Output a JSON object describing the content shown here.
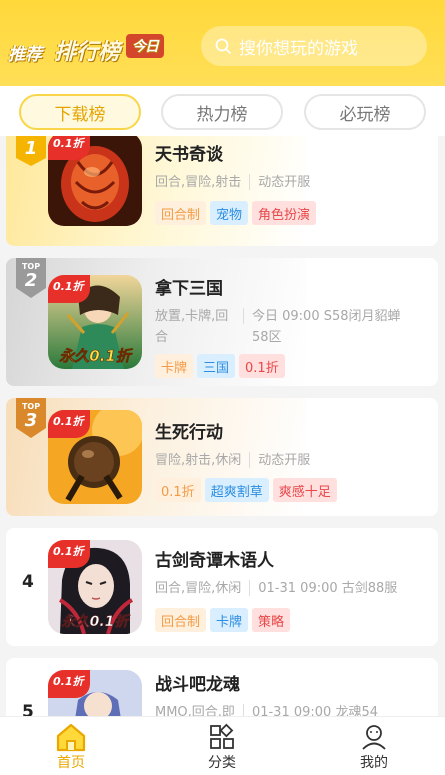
{
  "header": {
    "tabs": [
      "推荐",
      "排行榜",
      "今日"
    ],
    "search_placeholder": "搜你想玩的游戏"
  },
  "rank_tabs": [
    {
      "label": "下载榜",
      "active": true
    },
    {
      "label": "热力榜",
      "active": false
    },
    {
      "label": "必玩榜",
      "active": false
    }
  ],
  "games": [
    {
      "rank": "1",
      "badge_top": "",
      "discount": "0.1折",
      "title": "天书奇谈",
      "genre": "回合,冒险,射击",
      "info": "动态开服",
      "tags": [
        {
          "text": "回合制",
          "color": "orange"
        },
        {
          "text": "宠物",
          "color": "blue"
        },
        {
          "text": "角色扮演",
          "color": "red"
        }
      ]
    },
    {
      "rank": "2",
      "badge_top": "TOP",
      "discount": "0.1折",
      "title": "拿下三国",
      "genre": "放置,卡牌,回合",
      "info": "今日 09:00 S58闭月貂蝉58区",
      "icon_text": "永久0.1折",
      "tags": [
        {
          "text": "卡牌",
          "color": "orange"
        },
        {
          "text": "三国",
          "color": "blue"
        },
        {
          "text": "0.1折",
          "color": "red"
        }
      ]
    },
    {
      "rank": "3",
      "badge_top": "TOP",
      "discount": "0.1折",
      "title": "生死行动",
      "genre": "冒险,射击,休闲",
      "info": "动态开服",
      "tags": [
        {
          "text": "0.1折",
          "color": "orange"
        },
        {
          "text": "超爽割草",
          "color": "blue"
        },
        {
          "text": "爽感十足",
          "color": "red"
        }
      ]
    },
    {
      "rank": "4",
      "badge_top": "",
      "discount": "0.1折",
      "title": "古剑奇谭木语人",
      "genre": "回合,冒险,休闲",
      "info": "01-31 09:00 古剑88服",
      "icon_text": "永久0.1折",
      "tags": [
        {
          "text": "回合制",
          "color": "orange"
        },
        {
          "text": "卡牌",
          "color": "blue"
        },
        {
          "text": "策略",
          "color": "red"
        }
      ]
    },
    {
      "rank": "5",
      "badge_top": "",
      "discount": "0.1折",
      "title": "战斗吧龙魂",
      "genre": "MMO,回合,即",
      "info": "01-31 09:00 龙魂54",
      "tags": []
    }
  ],
  "bottom_nav": [
    {
      "label": "首页",
      "icon": "home-icon",
      "active": true
    },
    {
      "label": "分类",
      "icon": "category-icon",
      "active": false
    },
    {
      "label": "我的",
      "icon": "profile-icon",
      "active": false
    }
  ],
  "colors": {
    "brand_yellow": "#ffd83a",
    "active_text": "#e9a800",
    "discount_red": "#e8302b"
  }
}
